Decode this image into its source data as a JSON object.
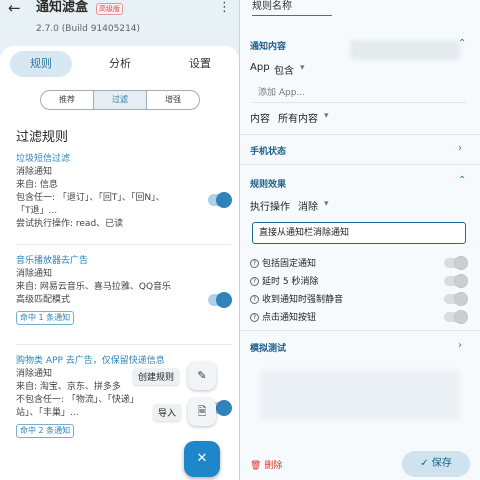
{
  "header": {
    "back_icon": "arrow-left-icon",
    "title": "通知滤盒",
    "badge": "高级版",
    "menu_icon": "more-vert-icon",
    "version": "2.7.0 (Build 91405214)"
  },
  "main_tabs": [
    {
      "label": "规则",
      "active": true
    },
    {
      "label": "分析",
      "active": false
    },
    {
      "label": "设置",
      "active": false
    }
  ],
  "sub_tabs": [
    {
      "label": "推荐",
      "selected": false
    },
    {
      "label": "过滤",
      "selected": true
    },
    {
      "label": "增强",
      "selected": false
    }
  ],
  "section_title": "过滤规则",
  "rules": [
    {
      "title": "垃圾短信过滤",
      "lines": [
        "消除通知",
        "来自: 信息",
        "包含任一: 「退订」、「回T」、「回N」、",
        "「T退」...",
        "尝试执行操作: read、已读"
      ],
      "chip": "",
      "enabled": true
    },
    {
      "title": "音乐播放器去广告",
      "lines": [
        "消除通知",
        "来自: 网易云音乐、喜马拉雅、QQ音乐",
        "高级匹配模式"
      ],
      "chip": "命中 1 条通知",
      "enabled": true
    },
    {
      "title": "购物类 APP 去广告，仅保留快递信息",
      "lines": [
        "消除通知",
        "来自: 淘宝、京东、拼多多",
        "不包含任一: 「物流」、「快递」",
        "站」、「丰巢」..."
      ],
      "chip": "命中 2 条通知",
      "enabled": true
    }
  ],
  "fab_menu": [
    {
      "label": "创建规则",
      "icon": "pencil-icon"
    },
    {
      "label": "导入",
      "icon": "file-icon"
    }
  ],
  "fab_icon": "close-icon",
  "editor": {
    "rule_name_placeholder": "规则名称",
    "sections": {
      "notification_content": "通知内容",
      "phone_state": "手机状态",
      "rule_effect": "规则效果",
      "simulation": "模拟测试"
    },
    "app_label": "App",
    "app_mode": "包含",
    "add_app": "添加 App...",
    "content_label": "内容",
    "content_value": "所有内容",
    "action_label": "执行操作",
    "action_value": "消除",
    "action_description": "直接从通知栏消除通知",
    "options": [
      {
        "label": "包括固定通知",
        "on": false
      },
      {
        "label": "延时 5 秒消除",
        "on": false
      },
      {
        "label": "收到通知时强制静音",
        "on": false
      },
      {
        "label": "点击通知按钮",
        "on": false
      }
    ],
    "delete_label": "删除",
    "save_label": "保存"
  }
}
